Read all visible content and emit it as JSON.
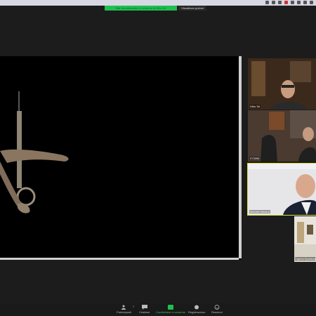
{
  "banner": {
    "sharing_text": "Stai visualizzando lo schermo di Hiho Srl",
    "view_options": "Visualizza opzioni"
  },
  "participants": [
    {
      "name": "Hiho Srl"
    },
    {
      "name": "073395"
    },
    {
      "name": "Michele Macina"
    },
    {
      "name": "Capriol Epcirezu"
    }
  ],
  "toolbar": {
    "participants_label": "Partecipanti",
    "participants_count": "7",
    "chat_label": "Chattare",
    "share_label": "Condividere lo schermo",
    "record_label": "Registrazione",
    "reactions_label": "Reazioni"
  },
  "colors": {
    "share_green": "#1fbf4f",
    "active_speaker": "#d8e03a",
    "background": "#1c1c1c"
  }
}
